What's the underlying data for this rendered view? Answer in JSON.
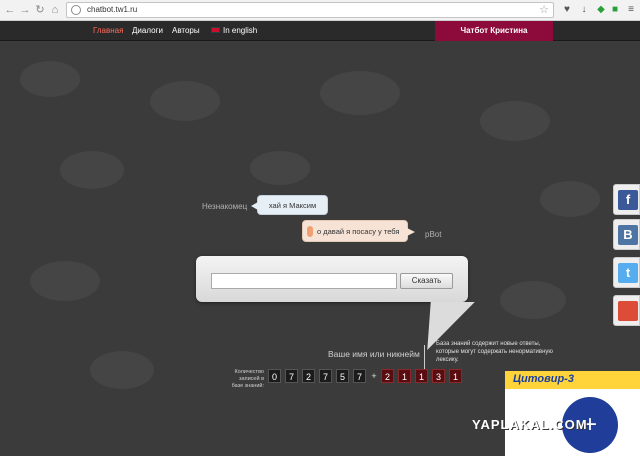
{
  "browser": {
    "url": "chatbot.tw1.ru",
    "icons": [
      "back-icon",
      "forward-icon",
      "refresh-icon",
      "home-icon",
      "globe-icon",
      "star-icon",
      "heart-icon",
      "download-icon",
      "shield-icon",
      "extension-icon",
      "menu-icon"
    ]
  },
  "nav": {
    "items": [
      "Главная",
      "Диалоги",
      "Авторы",
      "In english"
    ],
    "active_color": "#ff6a5a",
    "chatbot_tab": "Чатбот Кристина",
    "tab_color": "#8c0b3a"
  },
  "chat": {
    "stranger_label": "Незнакомец",
    "user_message": "хай я Максим",
    "bot_message": "о давай я посасу у тебя",
    "bot_label": "pBot"
  },
  "input": {
    "placeholder": "",
    "value": "",
    "button": "Сказать",
    "name_hint": "Ваше имя или никнейм"
  },
  "counter": {
    "label": "Количество записей в базе знаний:",
    "digits": [
      "0",
      "7",
      "2",
      "7",
      "5",
      "7"
    ],
    "plus": "+",
    "new_digits": [
      "2",
      "1",
      "1",
      "3",
      "1"
    ],
    "note": "База знаний содержит новые ответы, которые могут содержать ненормативную лексику."
  },
  "social": {
    "facebook": "f",
    "vk": "B",
    "twitter": "t"
  },
  "ad": {
    "title": "Цитовир-3"
  },
  "watermark": "YAPLAKAL.COM"
}
